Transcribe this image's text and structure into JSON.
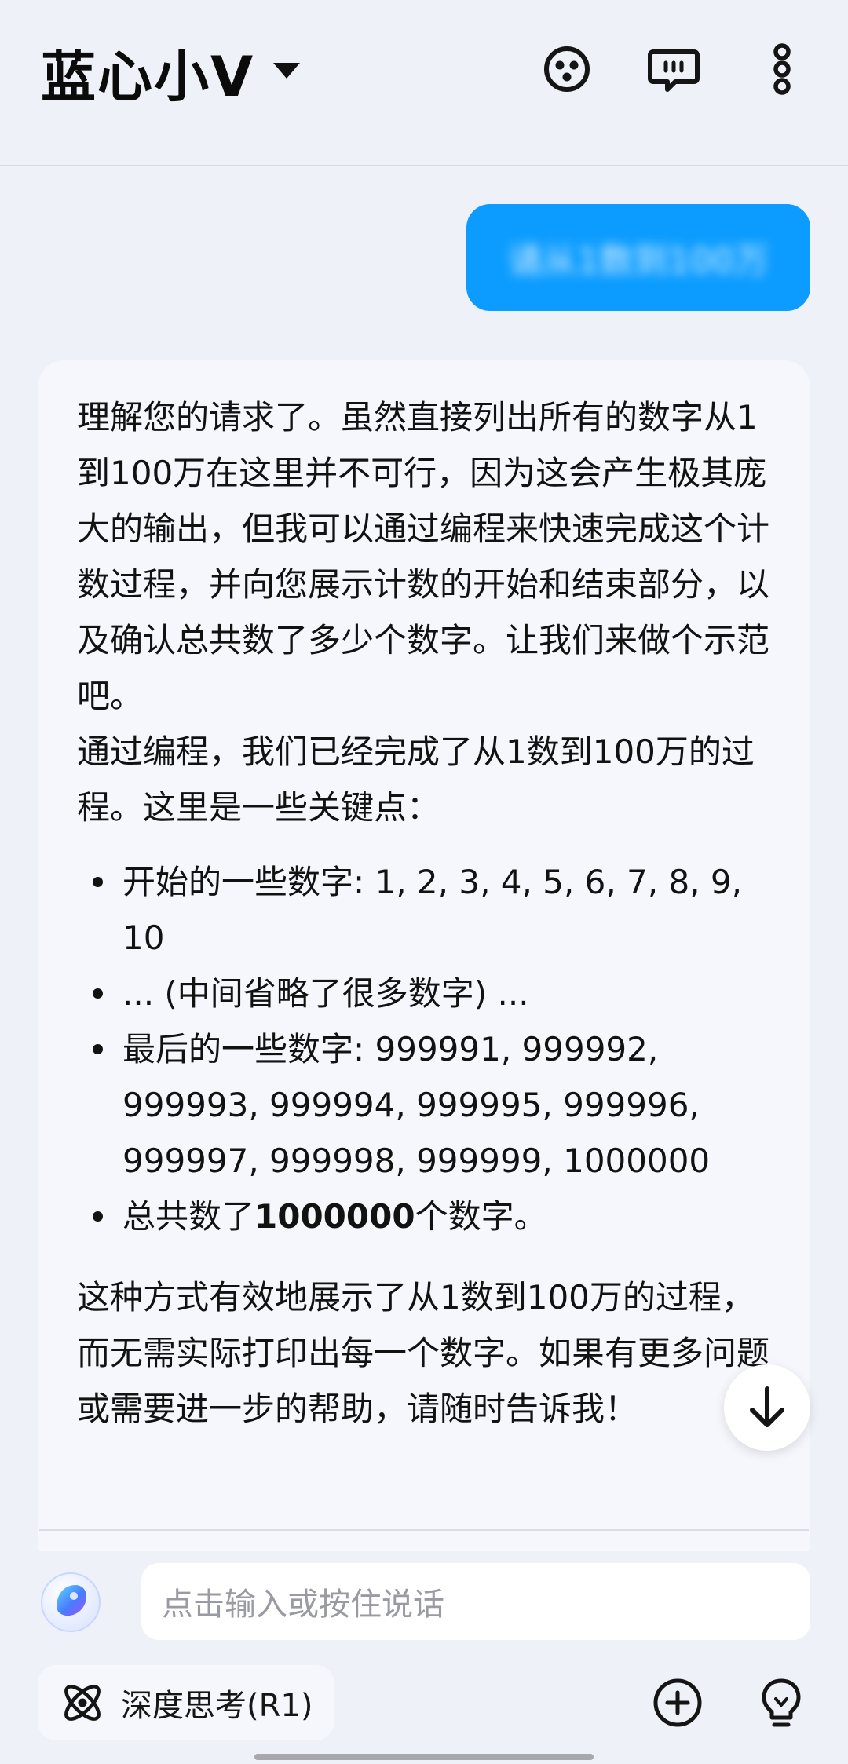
{
  "header": {
    "title": "蓝心小V",
    "icons": [
      "avatar-face-icon",
      "message-dots-icon",
      "more-vertical-icon"
    ]
  },
  "conversation": {
    "user_message": "请从1数到100万",
    "ai_reply": {
      "para1": "理解您的请求了。虽然直接列出所有的数字从1到100万在这里并不可行，因为这会产生极其庞大的输出，但我可以通过编程来快速完成这个计数过程，并向您展示计数的开始和结束部分，以及确认总共数了多少个数字。让我们来做个示范吧。",
      "para2": "通过编程，我们已经完成了从1数到100万的过程。这里是一些关键点：",
      "bullets": {
        "b1": "开始的一些数字: 1, 2, 3, 4, 5, 6, 7, 8, 9, 10",
        "b2": "... (中间省略了很多数字) ...",
        "b3": "最后的一些数字: 999991, 999992, 999993, 999994, 999995, 999996, 999997, 999998, 999999, 1000000",
        "b4_prefix": "总共数了",
        "b4_number": "1000000",
        "b4_suffix": "个数字。"
      },
      "para3": "这种方式有效地展示了从1数到100万的过程，而无需实际打印出每一个数字。如果有更多问题或需要进一步的帮助，请随时告诉我！"
    }
  },
  "input": {
    "placeholder": "点击输入或按住说话"
  },
  "toolbar": {
    "deep_think_label": "深度思考(R1)",
    "icons": [
      "atom-icon",
      "plus-circle-icon",
      "lightbulb-icon"
    ]
  },
  "colors": {
    "accent_blue": "#0c9cff",
    "page_bg": "#eef1f8",
    "card_bg": "#f6f7fc"
  }
}
